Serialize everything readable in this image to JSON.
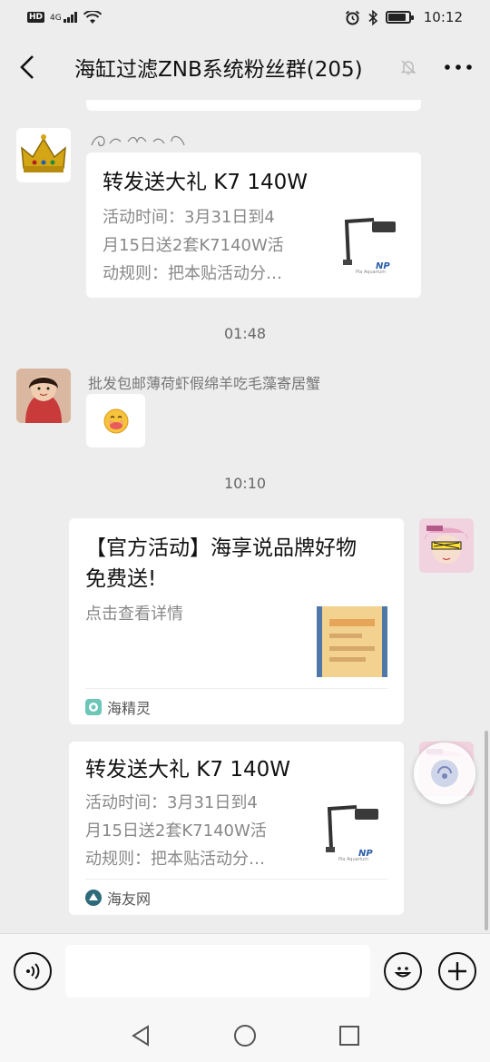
{
  "status": {
    "time": "10:12",
    "network": "4G",
    "hd": "HD"
  },
  "header": {
    "title": "海缸过滤ZNB系统粉丝群(205)"
  },
  "messages": {
    "card1": {
      "title": "转发送大礼 K7 140W",
      "desc_lines": [
        "活动时间：3月31日到4",
        "月15日送2套K7140W活",
        "动规则：把本贴活动分…"
      ]
    },
    "time1": "01:48",
    "msg2": {
      "sender": "批发包邮薄荷虾假绵羊吃毛藻寄居蟹",
      "emoji": "🤭"
    },
    "time2": "10:10",
    "card3": {
      "title_lines": [
        "【官方活动】海享说品牌好物",
        "免费送!"
      ],
      "desc": "点击查看详情",
      "source": "海精灵"
    },
    "card4": {
      "title": "转发送大礼 K7 140W",
      "desc_lines": [
        "活动时间：3月31日到4",
        "月15日送2套K7140W活",
        "动规则：把本贴活动分…"
      ],
      "source": "海友网"
    }
  },
  "colors": {
    "background": "#ededed",
    "bubble": "#ffffff",
    "accent_pink": "#e8a7c5"
  }
}
